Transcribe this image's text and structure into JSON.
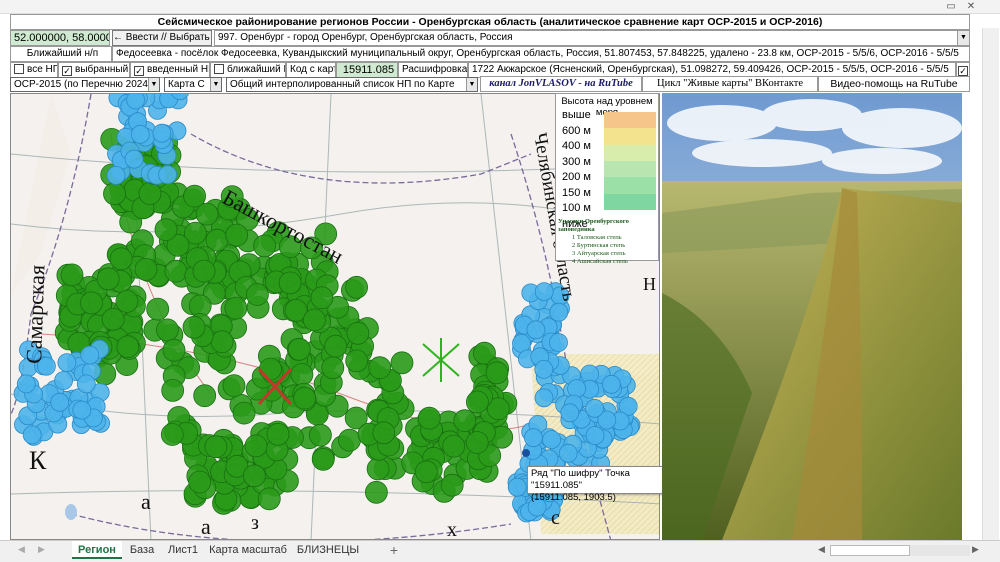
{
  "window": {
    "restore": "▭",
    "close": "✕"
  },
  "header": {
    "title": "Сейсмическое районирование регионов России - Оренбургская область (аналитическое сравнение карт ОСР-2015 и ОСР-2016)"
  },
  "row1": {
    "coords": "52.000000, 58.000000",
    "enter_btn": "← Ввести // Выбрать →",
    "city": "997. Оренбург - город Оренбург, Оренбургская область, Россия"
  },
  "row2": {
    "label": "Ближайший н/п",
    "value": "Федосеевка - посёлок Федосеевка, Кувандыкский муниципальный округ, Оренбургская область, Россия, 51.807453, 57.848225, удалено - 23.8 км, ОСР-2015 - 5/5/6, ОСР-2016 - 5/5/5"
  },
  "row3": {
    "all_np": "все НП",
    "sel_np": "выбранный НП",
    "entered_np": "введенный НП",
    "near_np": "ближайший НП",
    "code_label": "Код с карты",
    "code_value": "15911.085",
    "decode_label": "Расшифровка",
    "decode_value": "1722  Акжарское (Ясненский, Оренбургская), 51.098272, 59.409426, ОСР-2015 - 5/5/5, ОСР-2016 - 5/5/5"
  },
  "row4": {
    "osr": "ОСР-2015  (по Перечню 2024г.)",
    "map": "Карта С",
    "list": "Общий интерполированный список НП по Карте",
    "channel": "канал JonVLASOV - на RuTube",
    "cycle": "Цикл \"Живые карты\" ВКонтакте",
    "video": "Видео-помощь на RuTube"
  },
  "legend": {
    "title": "Высота над уровнем моря",
    "above": "выше",
    "levels": [
      "600 м",
      "400 м",
      "300 м",
      "200 м",
      "150 м",
      "100 м"
    ],
    "below": "ниже",
    "colors": [
      "#f6c58a",
      "#f3e38f",
      "#d8ecac",
      "#b9e6b0",
      "#9be0a6",
      "#7fd6a0"
    ],
    "reserve_title": "Участки Оренбургского заповедника",
    "reserve": [
      "1  Таловская степь",
      "2  Буртинская степь",
      "3  Айтуарская степь",
      "4  Ашисайская степь"
    ]
  },
  "map_labels": {
    "bashk": "Башкортостан",
    "chel": "Челябинская область",
    "samara": "Самарская",
    "k": "К",
    "a1": "а",
    "a2": "а",
    "z": "з",
    "x": "х",
    "s": "с",
    "n": "Н"
  },
  "tooltip": {
    "line1": "Ряд \"По шифру\" Точка \"15911.085\"",
    "line2": "(15911.085, 1903.5)"
  },
  "sheets": [
    "Регион",
    "База",
    "Лист1",
    "Карта масштаб",
    "БЛИЗНЕЦЫ"
  ],
  "sheet_add": "+",
  "colors": {
    "green_dot": "#2a9a1a",
    "blue_dot": "#4db4ea",
    "accent": "#217346"
  }
}
